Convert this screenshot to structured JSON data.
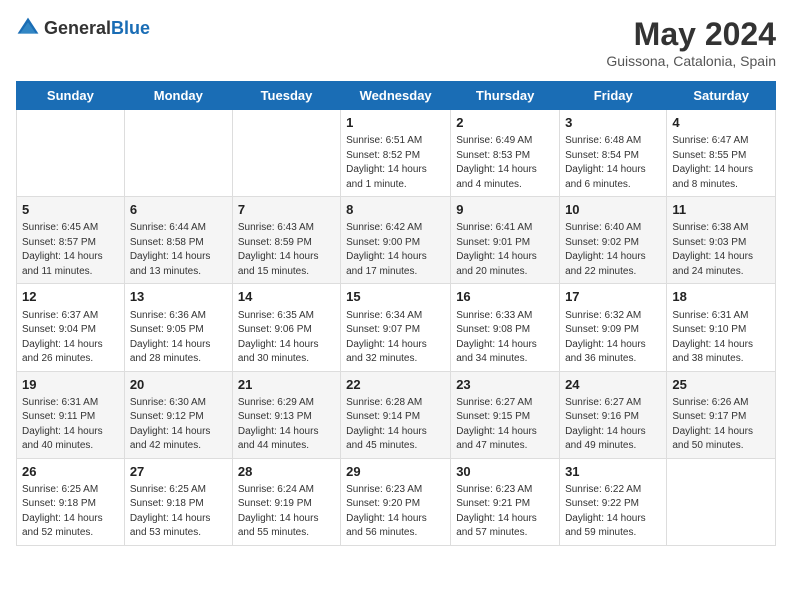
{
  "header": {
    "logo_general": "General",
    "logo_blue": "Blue",
    "month_year": "May 2024",
    "location": "Guissona, Catalonia, Spain"
  },
  "days_of_week": [
    "Sunday",
    "Monday",
    "Tuesday",
    "Wednesday",
    "Thursday",
    "Friday",
    "Saturday"
  ],
  "weeks": [
    [
      {
        "day": "",
        "info": ""
      },
      {
        "day": "",
        "info": ""
      },
      {
        "day": "",
        "info": ""
      },
      {
        "day": "1",
        "info": "Sunrise: 6:51 AM\nSunset: 8:52 PM\nDaylight: 14 hours\nand 1 minute."
      },
      {
        "day": "2",
        "info": "Sunrise: 6:49 AM\nSunset: 8:53 PM\nDaylight: 14 hours\nand 4 minutes."
      },
      {
        "day": "3",
        "info": "Sunrise: 6:48 AM\nSunset: 8:54 PM\nDaylight: 14 hours\nand 6 minutes."
      },
      {
        "day": "4",
        "info": "Sunrise: 6:47 AM\nSunset: 8:55 PM\nDaylight: 14 hours\nand 8 minutes."
      }
    ],
    [
      {
        "day": "5",
        "info": "Sunrise: 6:45 AM\nSunset: 8:57 PM\nDaylight: 14 hours\nand 11 minutes."
      },
      {
        "day": "6",
        "info": "Sunrise: 6:44 AM\nSunset: 8:58 PM\nDaylight: 14 hours\nand 13 minutes."
      },
      {
        "day": "7",
        "info": "Sunrise: 6:43 AM\nSunset: 8:59 PM\nDaylight: 14 hours\nand 15 minutes."
      },
      {
        "day": "8",
        "info": "Sunrise: 6:42 AM\nSunset: 9:00 PM\nDaylight: 14 hours\nand 17 minutes."
      },
      {
        "day": "9",
        "info": "Sunrise: 6:41 AM\nSunset: 9:01 PM\nDaylight: 14 hours\nand 20 minutes."
      },
      {
        "day": "10",
        "info": "Sunrise: 6:40 AM\nSunset: 9:02 PM\nDaylight: 14 hours\nand 22 minutes."
      },
      {
        "day": "11",
        "info": "Sunrise: 6:38 AM\nSunset: 9:03 PM\nDaylight: 14 hours\nand 24 minutes."
      }
    ],
    [
      {
        "day": "12",
        "info": "Sunrise: 6:37 AM\nSunset: 9:04 PM\nDaylight: 14 hours\nand 26 minutes."
      },
      {
        "day": "13",
        "info": "Sunrise: 6:36 AM\nSunset: 9:05 PM\nDaylight: 14 hours\nand 28 minutes."
      },
      {
        "day": "14",
        "info": "Sunrise: 6:35 AM\nSunset: 9:06 PM\nDaylight: 14 hours\nand 30 minutes."
      },
      {
        "day": "15",
        "info": "Sunrise: 6:34 AM\nSunset: 9:07 PM\nDaylight: 14 hours\nand 32 minutes."
      },
      {
        "day": "16",
        "info": "Sunrise: 6:33 AM\nSunset: 9:08 PM\nDaylight: 14 hours\nand 34 minutes."
      },
      {
        "day": "17",
        "info": "Sunrise: 6:32 AM\nSunset: 9:09 PM\nDaylight: 14 hours\nand 36 minutes."
      },
      {
        "day": "18",
        "info": "Sunrise: 6:31 AM\nSunset: 9:10 PM\nDaylight: 14 hours\nand 38 minutes."
      }
    ],
    [
      {
        "day": "19",
        "info": "Sunrise: 6:31 AM\nSunset: 9:11 PM\nDaylight: 14 hours\nand 40 minutes."
      },
      {
        "day": "20",
        "info": "Sunrise: 6:30 AM\nSunset: 9:12 PM\nDaylight: 14 hours\nand 42 minutes."
      },
      {
        "day": "21",
        "info": "Sunrise: 6:29 AM\nSunset: 9:13 PM\nDaylight: 14 hours\nand 44 minutes."
      },
      {
        "day": "22",
        "info": "Sunrise: 6:28 AM\nSunset: 9:14 PM\nDaylight: 14 hours\nand 45 minutes."
      },
      {
        "day": "23",
        "info": "Sunrise: 6:27 AM\nSunset: 9:15 PM\nDaylight: 14 hours\nand 47 minutes."
      },
      {
        "day": "24",
        "info": "Sunrise: 6:27 AM\nSunset: 9:16 PM\nDaylight: 14 hours\nand 49 minutes."
      },
      {
        "day": "25",
        "info": "Sunrise: 6:26 AM\nSunset: 9:17 PM\nDaylight: 14 hours\nand 50 minutes."
      }
    ],
    [
      {
        "day": "26",
        "info": "Sunrise: 6:25 AM\nSunset: 9:18 PM\nDaylight: 14 hours\nand 52 minutes."
      },
      {
        "day": "27",
        "info": "Sunrise: 6:25 AM\nSunset: 9:18 PM\nDaylight: 14 hours\nand 53 minutes."
      },
      {
        "day": "28",
        "info": "Sunrise: 6:24 AM\nSunset: 9:19 PM\nDaylight: 14 hours\nand 55 minutes."
      },
      {
        "day": "29",
        "info": "Sunrise: 6:23 AM\nSunset: 9:20 PM\nDaylight: 14 hours\nand 56 minutes."
      },
      {
        "day": "30",
        "info": "Sunrise: 6:23 AM\nSunset: 9:21 PM\nDaylight: 14 hours\nand 57 minutes."
      },
      {
        "day": "31",
        "info": "Sunrise: 6:22 AM\nSunset: 9:22 PM\nDaylight: 14 hours\nand 59 minutes."
      },
      {
        "day": "",
        "info": ""
      }
    ]
  ]
}
